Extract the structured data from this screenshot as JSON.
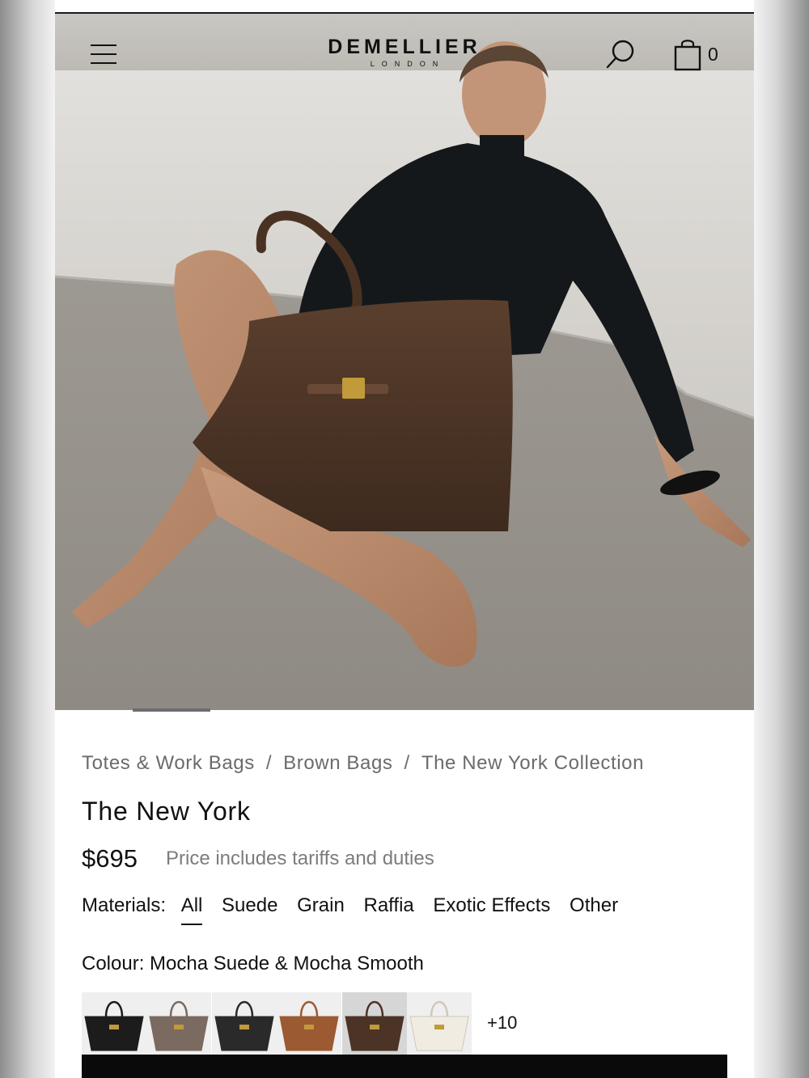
{
  "brand": {
    "name": "DEMELLIER",
    "tagline": "LONDON"
  },
  "header": {
    "cart_count": "0"
  },
  "breadcrumb": [
    "Totes & Work Bags",
    "Brown Bags",
    "The New York Collection"
  ],
  "breadcrumb_sep": "/",
  "product": {
    "title": "The New York",
    "price": "$695",
    "price_note": "Price includes tariffs and duties"
  },
  "materials": {
    "label": "Materials:",
    "options": [
      "All",
      "Suede",
      "Grain",
      "Raffia",
      "Exotic Effects",
      "Other"
    ],
    "selected": "All"
  },
  "colour": {
    "label": "Colour: Mocha Suede & Mocha Smooth",
    "swatches": [
      {
        "name": "black",
        "color": "#1c1c1c"
      },
      {
        "name": "grey-taupe",
        "color": "#7a6a60"
      },
      {
        "name": "black-croc",
        "color": "#2a2a2a"
      },
      {
        "name": "tan",
        "color": "#9b5a32"
      },
      {
        "name": "mocha",
        "color": "#4b3325",
        "selected": true
      },
      {
        "name": "cream",
        "color": "#f1ece2"
      }
    ],
    "more": "+10"
  }
}
